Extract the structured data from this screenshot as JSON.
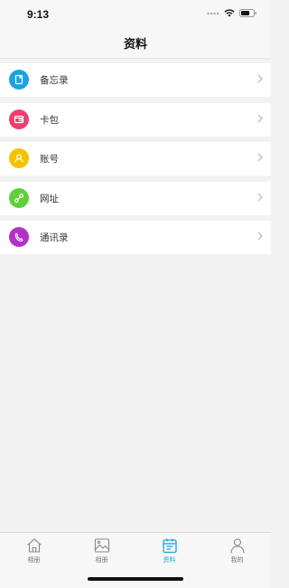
{
  "status_bar": {
    "time": "9:13",
    "icons": [
      "signal-dots-icon",
      "wifi-icon",
      "battery-icon"
    ]
  },
  "header": {
    "title": "资料"
  },
  "menu": {
    "items": [
      {
        "label": "备忘录",
        "icon": "notebook-icon",
        "color": "#1aa3e0"
      },
      {
        "label": "卡包",
        "icon": "wallet-icon",
        "color": "#ec3f6e"
      },
      {
        "label": "账号",
        "icon": "user-icon",
        "color": "#f5c200"
      },
      {
        "label": "网址",
        "icon": "link-icon",
        "color": "#5fcf3a"
      },
      {
        "label": "通讯录",
        "icon": "phone-icon",
        "color": "#b530c8"
      }
    ]
  },
  "tab_bar": {
    "tabs": [
      {
        "label": "相册",
        "icon": "home-icon",
        "active": false
      },
      {
        "label": "相册",
        "icon": "picture-icon",
        "active": false
      },
      {
        "label": "资料",
        "icon": "calendar-icon",
        "active": true
      },
      {
        "label": "我的",
        "icon": "person-icon",
        "active": false
      }
    ],
    "active_color": "#1aa3e0",
    "inactive_color": "#777777"
  }
}
